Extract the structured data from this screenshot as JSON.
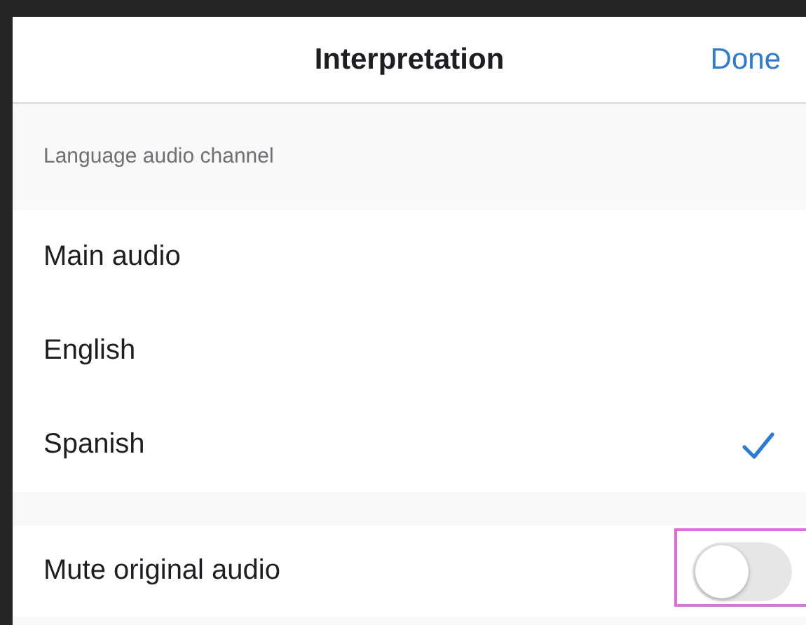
{
  "nav": {
    "title": "Interpretation",
    "done": "Done"
  },
  "section_header": "Language audio channel",
  "options": [
    {
      "label": "Main audio",
      "selected": false
    },
    {
      "label": "English",
      "selected": false
    },
    {
      "label": "Spanish",
      "selected": true
    }
  ],
  "mute": {
    "label": "Mute original audio",
    "on": false,
    "highlighted": true
  }
}
